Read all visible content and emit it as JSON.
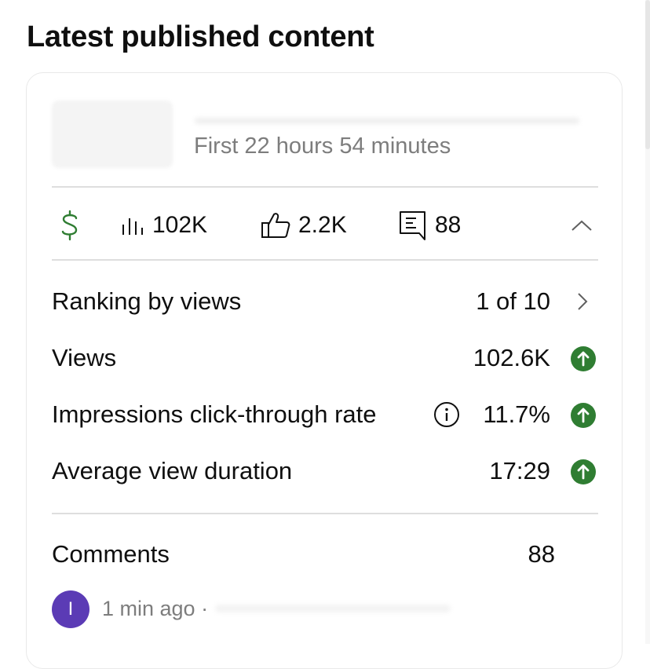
{
  "section": {
    "title": "Latest published content"
  },
  "video": {
    "meta": "First 22 hours 54 minutes"
  },
  "stats": {
    "revenue_icon": "dollar-icon",
    "views_icon": "bar-chart-icon",
    "views": "102K",
    "likes_icon": "thumbs-up-icon",
    "likes": "2.2K",
    "comments_icon": "comment-icon",
    "comments": "88",
    "collapse_icon": "chevron-up-icon"
  },
  "metrics": [
    {
      "label": "Ranking by views",
      "value": "1 of 10",
      "indicator": "chevron-right-icon"
    },
    {
      "label": "Views",
      "value": "102.6K",
      "indicator": "arrow-up-icon"
    },
    {
      "label": "Impressions click-through rate",
      "value": "11.7%",
      "indicator": "arrow-up-icon",
      "info_icon": "info-icon"
    },
    {
      "label": "Average view duration",
      "value": "17:29",
      "indicator": "arrow-up-icon"
    }
  ],
  "comments_section": {
    "label": "Comments",
    "count": "88",
    "latest": {
      "avatar_initial": "I",
      "time": "1 min ago ·"
    }
  },
  "colors": {
    "positive": "#2f7d32",
    "revenue": "#2f7d32",
    "avatar": "#5b3bb5"
  }
}
